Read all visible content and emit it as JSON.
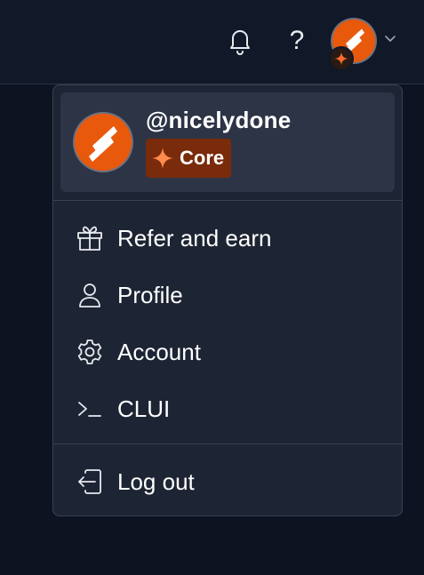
{
  "header": {
    "notifications_icon": "bell-icon",
    "help_glyph": "?",
    "avatar_icon": "user-avatar-logo",
    "menu_chevron_icon": "chevron-down-icon"
  },
  "user": {
    "handle": "@nicelydone",
    "plan": "Core",
    "plan_icon": "sparkle-icon"
  },
  "menu": {
    "items": [
      {
        "label": "Refer and earn",
        "icon": "gift-icon"
      },
      {
        "label": "Profile",
        "icon": "user-icon"
      },
      {
        "label": "Account",
        "icon": "gear-icon"
      },
      {
        "label": "CLUI",
        "icon": "terminal-icon"
      }
    ],
    "logout": {
      "label": "Log out",
      "icon": "logout-icon"
    }
  },
  "colors": {
    "background": "#0e1322",
    "topbar": "#111827",
    "menu": "#1d2433",
    "user_card": "#2d3446",
    "accent": "#e8590c",
    "badge": "#7a2b0b"
  }
}
